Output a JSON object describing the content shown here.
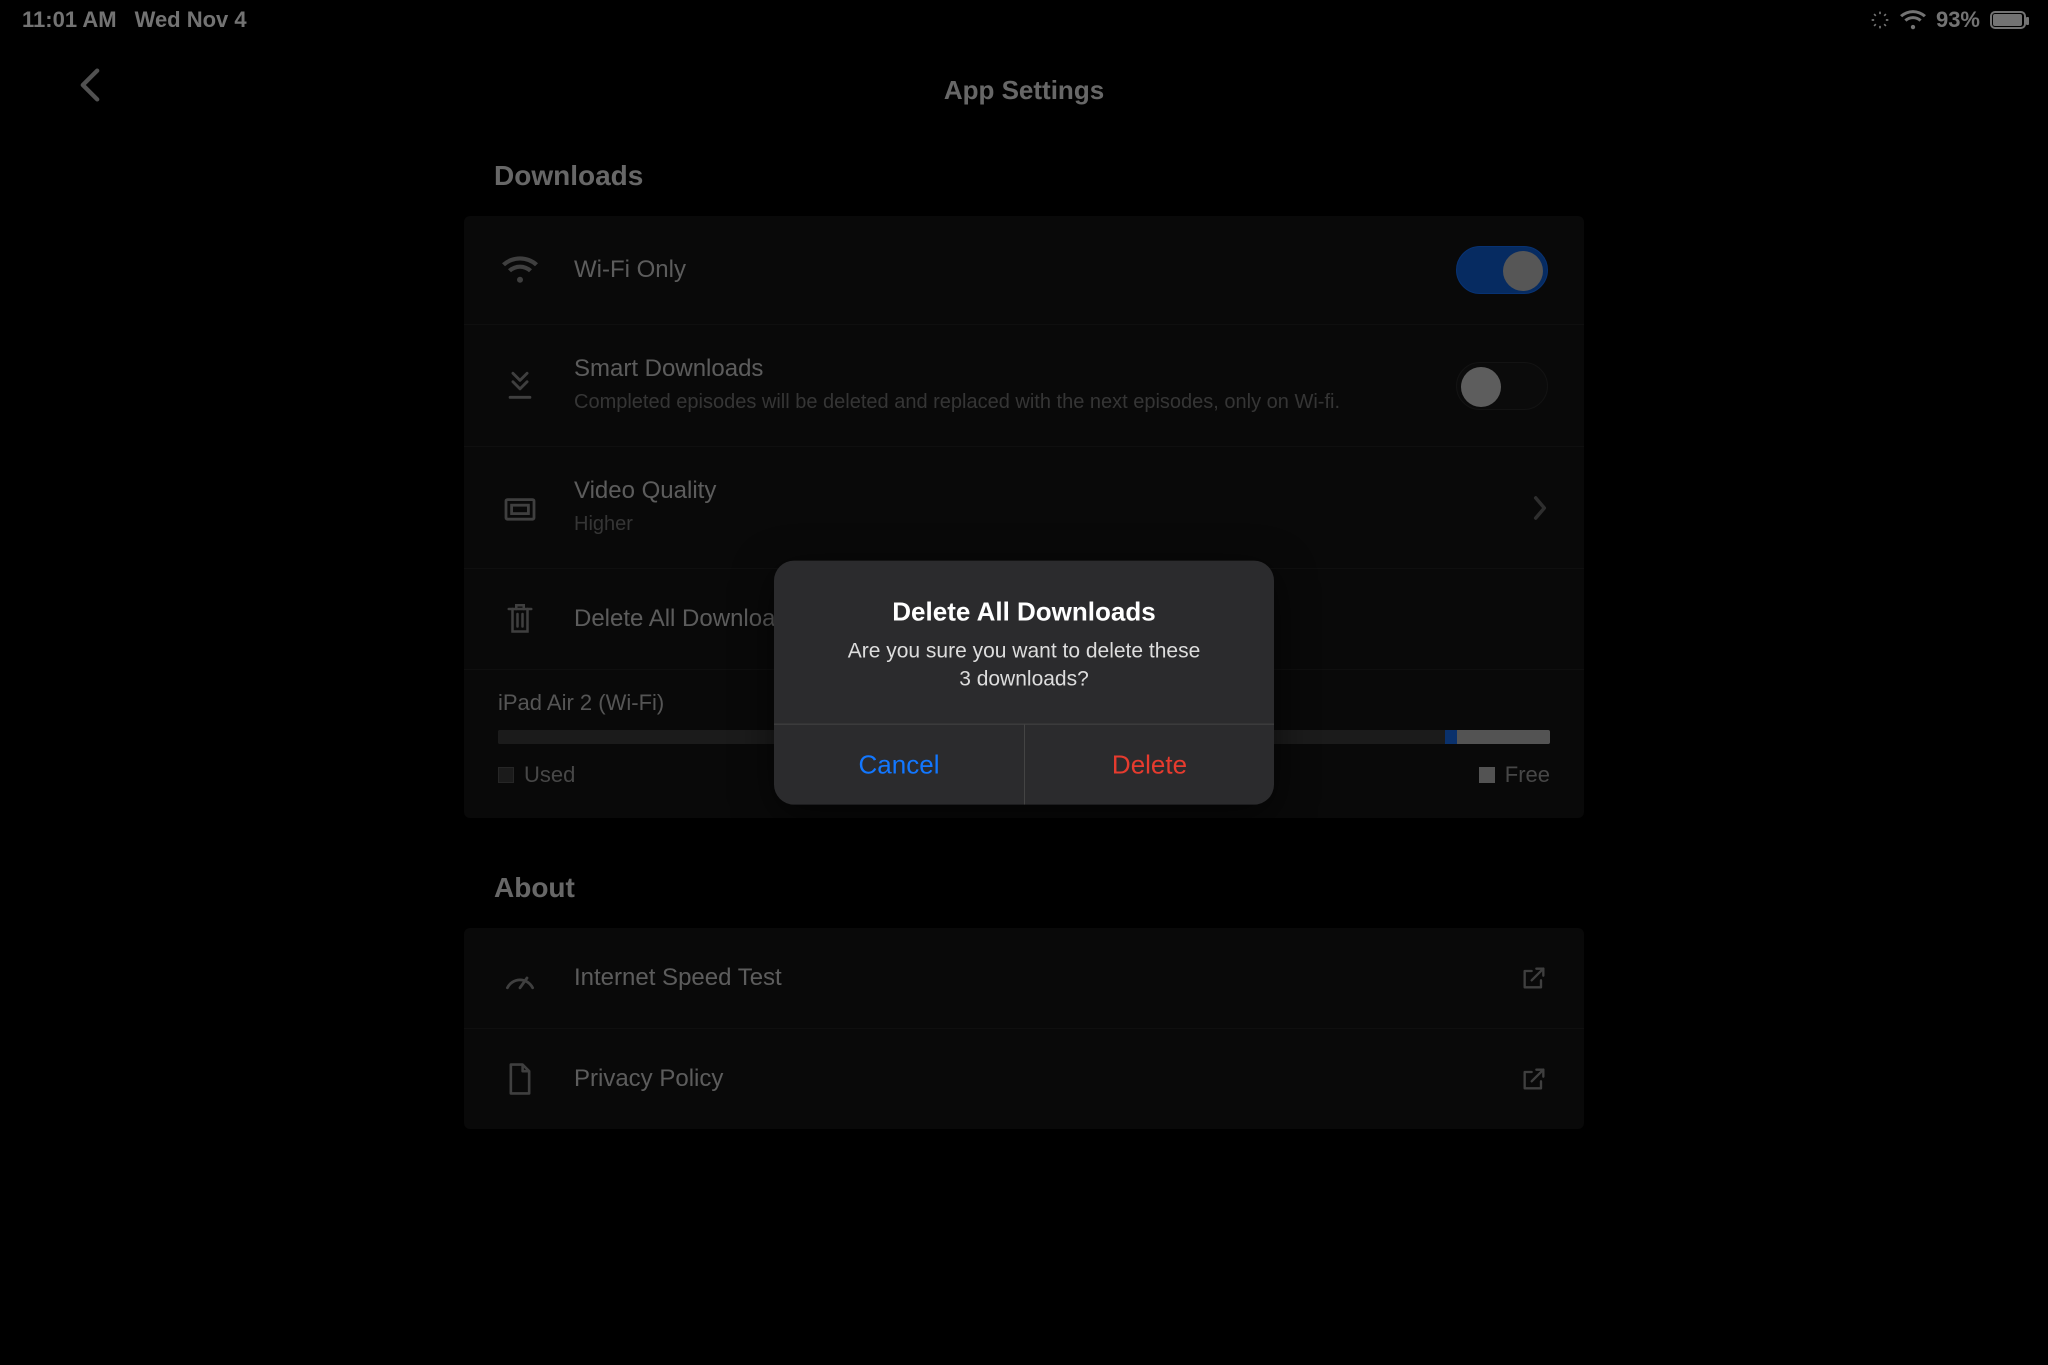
{
  "status": {
    "time": "11:01 AM",
    "date": "Wed Nov 4",
    "battery_percent": "93%"
  },
  "header": {
    "title": "App Settings"
  },
  "downloads": {
    "section_title": "Downloads",
    "wifi_only": {
      "label": "Wi-Fi Only",
      "on": true
    },
    "smart_downloads": {
      "label": "Smart Downloads",
      "description": "Completed episodes will be deleted and replaced with the next episodes, only on Wi-fi.",
      "on": false
    },
    "video_quality": {
      "label": "Video Quality",
      "value": "Higher"
    },
    "delete_all": {
      "label": "Delete All Downloads"
    },
    "storage": {
      "device_name": "iPad Air 2 (Wi-Fi)",
      "legend_used": "Used",
      "legend_free": "Free"
    }
  },
  "about": {
    "section_title": "About",
    "speed_test": {
      "label": "Internet Speed Test"
    },
    "privacy": {
      "label": "Privacy Policy"
    }
  },
  "dialog": {
    "title": "Delete All Downloads",
    "message": "Are you sure you want to delete these\n3 downloads?",
    "cancel": "Cancel",
    "confirm": "Delete"
  }
}
